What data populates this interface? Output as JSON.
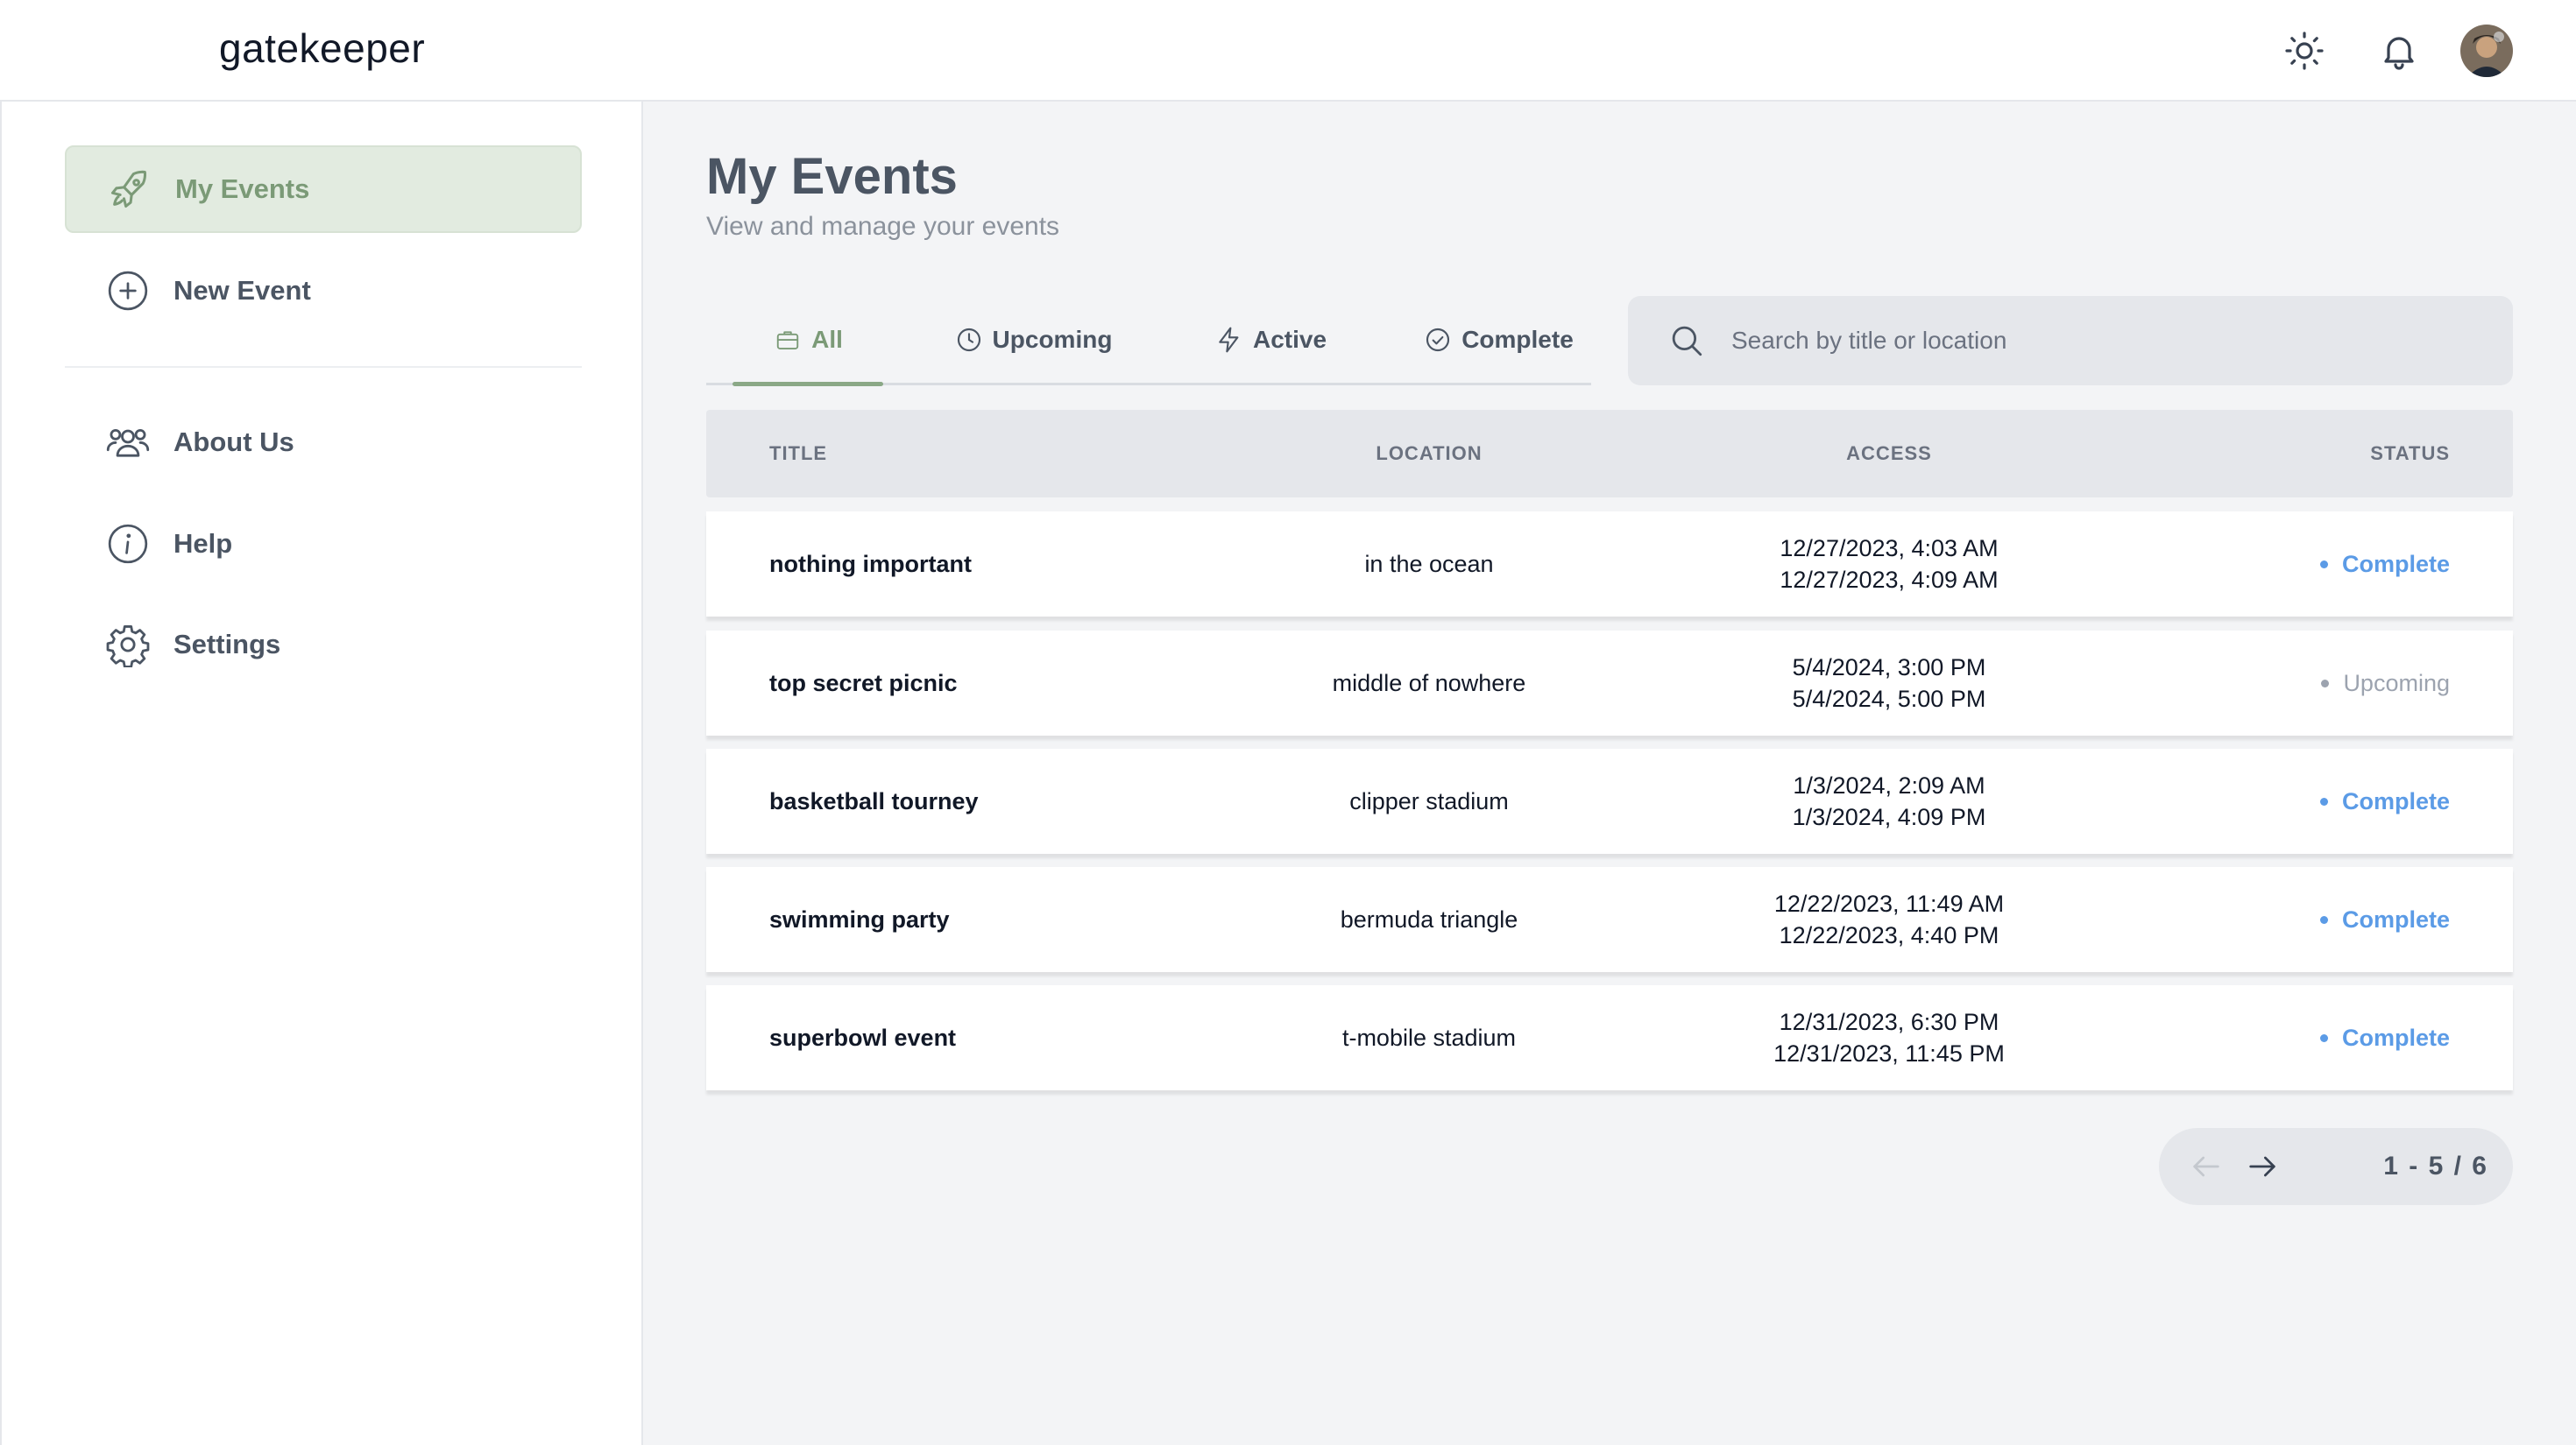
{
  "app": {
    "brand": "gatekeeper"
  },
  "header": {
    "icons": [
      "sun-icon",
      "bell-icon",
      "avatar"
    ]
  },
  "sidebar": {
    "items": [
      {
        "label": "My Events",
        "icon": "rocket-icon",
        "active": true
      },
      {
        "label": "New Event",
        "icon": "plus-circle-icon"
      },
      {
        "label": "About Us",
        "icon": "users-icon"
      },
      {
        "label": "Help",
        "icon": "info-icon"
      },
      {
        "label": "Settings",
        "icon": "gear-icon"
      }
    ]
  },
  "main": {
    "title": "My Events",
    "subtitle": "View and manage your events",
    "tabs": [
      {
        "label": "All",
        "icon": "briefcase-icon",
        "active": true
      },
      {
        "label": "Upcoming",
        "icon": "clock-icon"
      },
      {
        "label": "Active",
        "icon": "bolt-icon"
      },
      {
        "label": "Complete",
        "icon": "check-circle-icon"
      }
    ],
    "search": {
      "placeholder": "Search by title or location",
      "value": ""
    },
    "table": {
      "columns": {
        "title": "TITLE",
        "location": "LOCATION",
        "access": "ACCESS",
        "status": "STATUS"
      },
      "rows": [
        {
          "title": "nothing important",
          "location": "in the ocean",
          "start": "12/27/2023, 4:03 AM",
          "end": "12/27/2023, 4:09 AM",
          "status": "Complete"
        },
        {
          "title": "top secret picnic",
          "location": "middle of nowhere",
          "start": "5/4/2024, 3:00 PM",
          "end": "5/4/2024, 5:00 PM",
          "status": "Upcoming"
        },
        {
          "title": "basketball tourney",
          "location": "clipper stadium",
          "start": "1/3/2024, 2:09 AM",
          "end": "1/3/2024, 4:09 PM",
          "status": "Complete"
        },
        {
          "title": "swimming party",
          "location": "bermuda triangle",
          "start": "12/22/2023, 11:49 AM",
          "end": "12/22/2023, 4:40 PM",
          "status": "Complete"
        },
        {
          "title": "superbowl event",
          "location": "t-mobile stadium",
          "start": "12/31/2023, 6:30 PM",
          "end": "12/31/2023, 11:45 PM",
          "status": "Complete"
        }
      ]
    },
    "pagination": {
      "range": "1 - 5",
      "total": "/ 6"
    }
  },
  "colors": {
    "accent": "#7b9a77",
    "accent_bg": "#e2ebe0",
    "complete": "#5b9be6",
    "upcoming": "#9ca3af"
  }
}
